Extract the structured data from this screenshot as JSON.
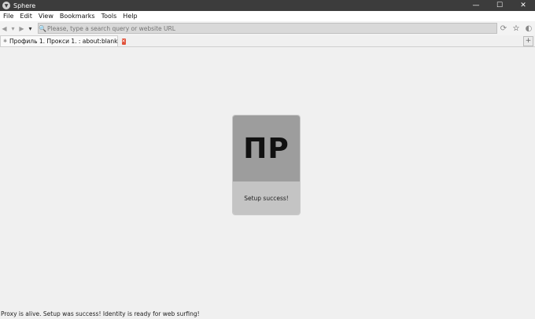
{
  "window": {
    "title": "Sphere",
    "controls": {
      "minimize": "—",
      "maximize": "☐",
      "close": "✕"
    }
  },
  "menu": [
    "File",
    "Edit",
    "View",
    "Bookmarks",
    "Tools",
    "Help"
  ],
  "navbar": {
    "url_placeholder": "Please, type a search query or website URL",
    "url_value": ""
  },
  "tabs": [
    {
      "label": "Профиль 1. Прокси 1. : about:blank",
      "active": true
    }
  ],
  "card": {
    "initials": "ПР",
    "status": "Setup success!"
  },
  "status_bar": {
    "text": "Proxy is alive. Setup was success! Identity is ready for web surfing!"
  },
  "colors": {
    "titlebar": "#3c3c3c",
    "card_top": "#9d9d9d",
    "card_bottom": "#c4c4c4",
    "tab_close": "#e0523a"
  }
}
